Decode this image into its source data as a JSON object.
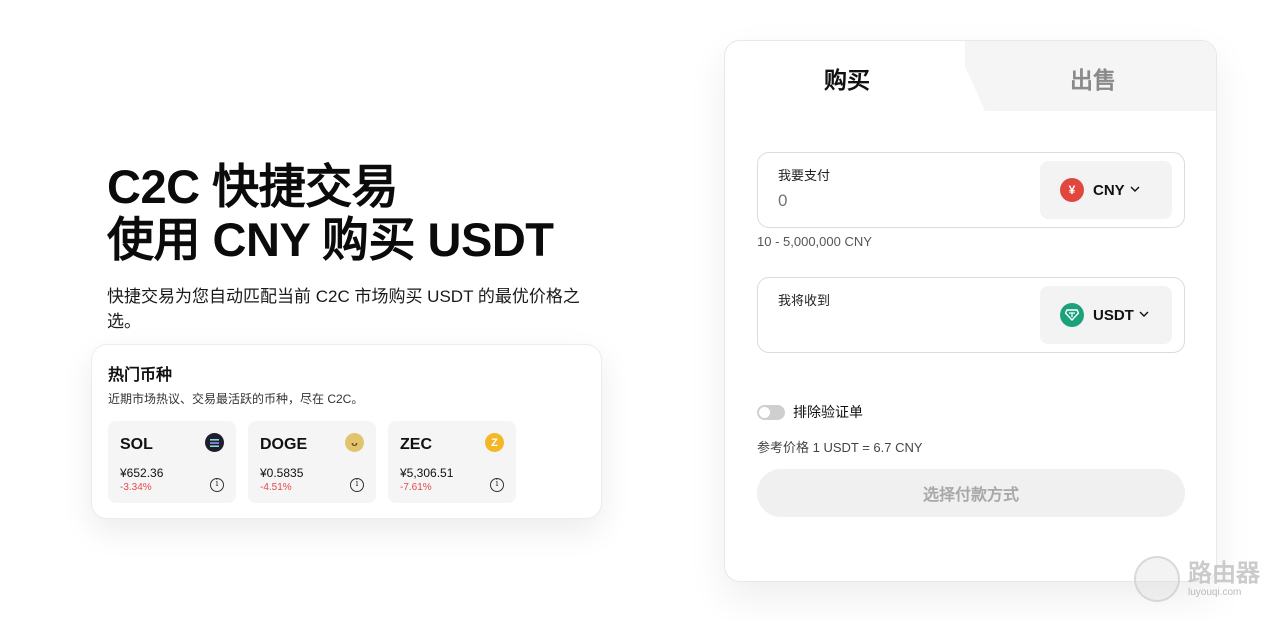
{
  "hero": {
    "title_line1": "C2C 快捷交易",
    "title_line2": "使用 CNY 购买 USDT",
    "description": "快捷交易为您自动匹配当前 C2C 市场购买 USDT 的最优价格之选。"
  },
  "hot": {
    "title": "热门币种",
    "subtitle": "近期市场热议、交易最活跃的币种，尽在 C2C。",
    "coins": [
      {
        "symbol": "SOL",
        "price": "¥652.36",
        "change": "-3.34%",
        "icon": "solana-icon",
        "color": "#1a1a2e"
      },
      {
        "symbol": "DOGE",
        "price": "¥0.5835",
        "change": "-4.51%",
        "icon": "dogecoin-icon",
        "color": "#e0c36a"
      },
      {
        "symbol": "ZEC",
        "price": "¥5,306.51",
        "change": "-7.61%",
        "icon": "zcash-icon",
        "color": "#f4b728"
      }
    ]
  },
  "trade": {
    "tab_buy": "购买",
    "tab_sell": "出售",
    "pay": {
      "label": "我要支付",
      "placeholder": "0",
      "currency": "CNY",
      "currency_icon": "¥",
      "currency_color": "#e2473d"
    },
    "range": "10 - 5,000,000 CNY",
    "receive": {
      "label": "我将收到",
      "currency": "USDT",
      "currency_color": "#1ba27a"
    },
    "toggle_label": "排除验证单",
    "ref_price": "参考价格 1 USDT = 6.7 CNY",
    "button": "选择付款方式"
  },
  "watermark": {
    "cn": "路由器",
    "en": "luyouqi.com"
  }
}
